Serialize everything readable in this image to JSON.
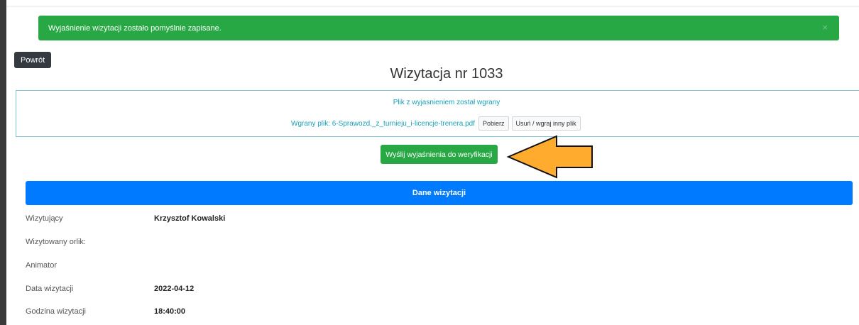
{
  "alert": {
    "message": "Wyjaśnienie wizytacji zostało pomyślnie zapisane.",
    "close_glyph": "×",
    "color": "#28a745"
  },
  "back_button": {
    "label": "Powrót"
  },
  "title": "Wizytacja nr 1033",
  "file": {
    "status": "Plik z wyjasnieniem został wgrany",
    "label": "Wgrany plik: 6-Sprawozd._z_turnieju_i-licencje-trenera.pdf",
    "download_label": "Pobierz",
    "replace_label": "Usuń / wgraj inny plik"
  },
  "submit_button": {
    "label": "Wyślij wyjaśnienia do weryfikacji"
  },
  "annotation": {
    "arrow_color": "#ffab2e",
    "arrow_direction": "left"
  },
  "section": {
    "title": "Dane wizytacji",
    "color": "#007bff"
  },
  "details": [
    {
      "label": "Wizytujący",
      "value": "Krzysztof Kowalski"
    },
    {
      "label": "Wizytowany orlik:",
      "value": ""
    },
    {
      "label": "Animator",
      "value": ""
    },
    {
      "label": "Data wizytacji",
      "value": "2022-04-12"
    },
    {
      "label": "Godzina wizytacji",
      "value": "18:40:00"
    }
  ]
}
